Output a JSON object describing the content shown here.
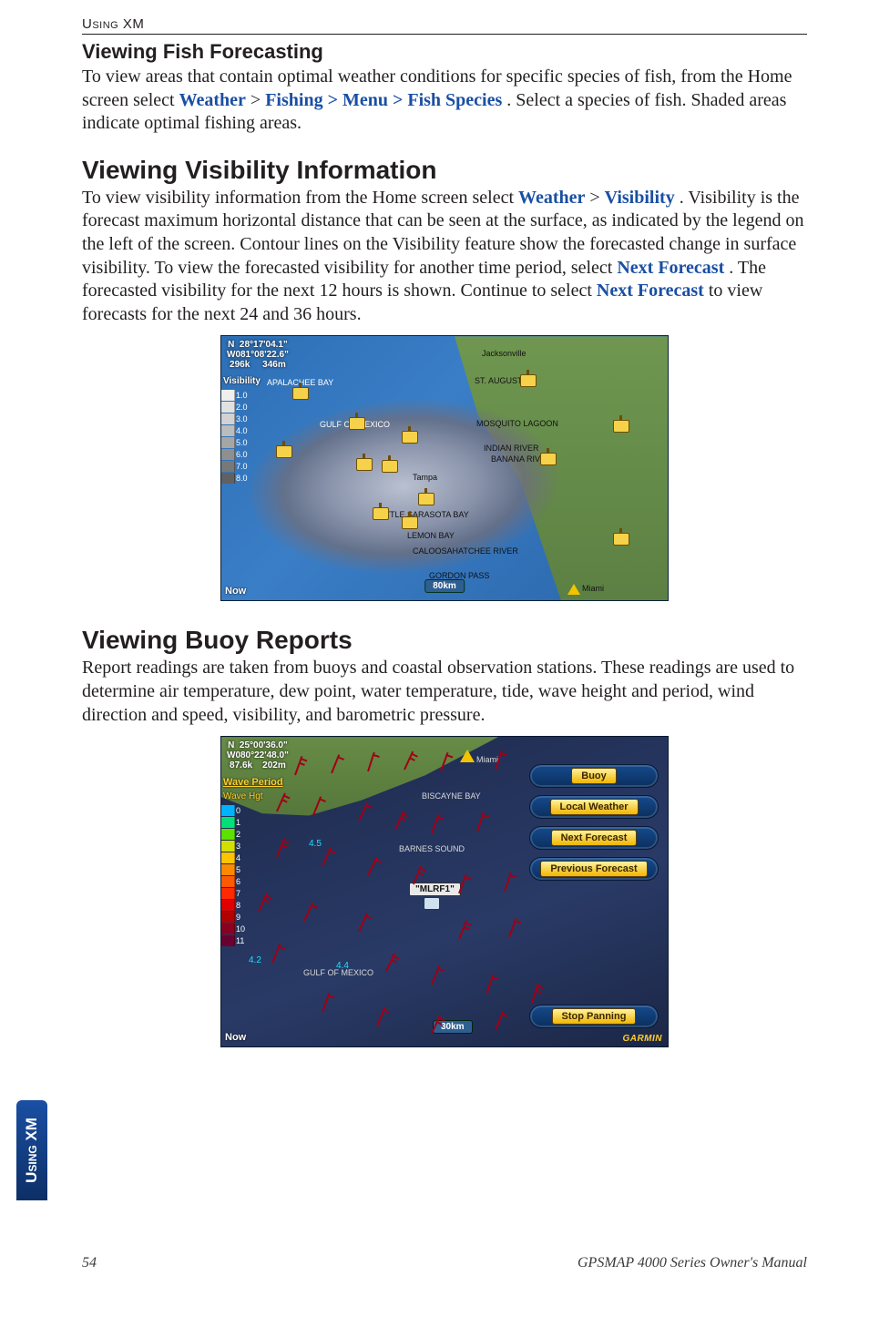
{
  "running_head": "Using XM",
  "fish": {
    "heading": "Viewing Fish Forecasting",
    "p_lead": "To view areas that contain optimal weather conditions for specific species of fish, from the Home screen select ",
    "nav": [
      "Weather",
      "Fishing",
      "Menu",
      "Fish Species"
    ],
    "p_tail": ". Select a species of fish. Shaded areas indicate optimal fishing areas."
  },
  "visibility": {
    "heading": "Viewing Visibility Information",
    "p_lead": "To view visibility information from the Home screen select ",
    "nav1": [
      "Weather",
      "Visibility"
    ],
    "p_mid1": ". Visibility is the forecast maximum horizontal distance that can be seen at the surface, as indicated by the legend on the left of the screen. Contour lines on the Visibility feature show the forecasted change in surface visibility. To view the forecasted visibility for another time period, select ",
    "link_next1": "Next Forecast",
    "p_mid2": ". The forecasted visibility for the next 12 hours is shown. Continue to select ",
    "link_next2": "Next Forecast",
    "p_tail": " to view forecasts for the next 24 and 36 hours."
  },
  "fig1": {
    "coords": "N  28°17'04.1\"\nW081°08'22.6\"\n296k     346m",
    "legend_title": "Visibility",
    "legend": [
      {
        "v": "1.0",
        "c": "#efefef"
      },
      {
        "v": "2.0",
        "c": "#e1e1e1"
      },
      {
        "v": "3.0",
        "c": "#d2d2d2"
      },
      {
        "v": "4.0",
        "c": "#bcbcbc"
      },
      {
        "v": "5.0",
        "c": "#a6a6a6"
      },
      {
        "v": "6.0",
        "c": "#8f8f8f"
      },
      {
        "v": "7.0",
        "c": "#787878"
      },
      {
        "v": "8.0",
        "c": "#616161"
      }
    ],
    "now": "Now",
    "scale": "80km",
    "labels": {
      "jacksonville": "Jacksonville",
      "st_augustine": "ST. AUGUSTINE",
      "gulf": "GULF OF MEXICO",
      "mosquito": "MOSQUITO LAGOON",
      "indian": "INDIAN RIVER",
      "banana": "BANANA RIVER",
      "tampa": "Tampa",
      "little": "LITTLE SARASOTA BAY",
      "lemon": "LEMON BAY",
      "caloosa": "CALOOSAHATCHEE RIVER",
      "gordon": "GORDON PASS",
      "miami": "Miami",
      "apalachee": "APALACHEE BAY"
    }
  },
  "buoy": {
    "heading": "Viewing Buoy Reports",
    "p": "Report readings are taken from buoys and coastal observation stations. These readings are used to determine air temperature, dew point, water temperature, tide, wave height and period, wind direction and speed, visibility, and barometric pressure."
  },
  "fig2": {
    "coords": "N  25°00'36.0\"\nW080°22'48.0\"\n87.6k    202m",
    "legend_title": "Wave Period",
    "legend_sub": "Wave Hgt",
    "legend": [
      {
        "v": "0",
        "c": "#00b3ff"
      },
      {
        "v": "1",
        "c": "#00e07a"
      },
      {
        "v": "2",
        "c": "#5de000"
      },
      {
        "v": "3",
        "c": "#d2e000"
      },
      {
        "v": "4",
        "c": "#ffc400"
      },
      {
        "v": "5",
        "c": "#ff8a00"
      },
      {
        "v": "6",
        "c": "#ff5a00"
      },
      {
        "v": "7",
        "c": "#ff2a00"
      },
      {
        "v": "8",
        "c": "#e00000"
      },
      {
        "v": "9",
        "c": "#b00000"
      },
      {
        "v": "10",
        "c": "#8a0020"
      },
      {
        "v": "11",
        "c": "#6a0030"
      }
    ],
    "now": "Now",
    "brand": "GARMIN",
    "scale": "30km",
    "buttons": {
      "buoy": "Buoy",
      "local": "Local Weather",
      "next": "Next Forecast",
      "prev": "Previous Forecast",
      "stop": "Stop Panning"
    },
    "station": "\"MLRF1\"",
    "labels": {
      "biscayne": "BISCAYNE BAY",
      "barnes": "BARNES SOUND",
      "gulf": "GULF OF MEXICO",
      "miami": "Miami"
    },
    "depths": [
      "4.2",
      "4.5",
      "4.4"
    ]
  },
  "side_tab": "Using XM",
  "footer": {
    "page": "54",
    "manual": "GPSMAP 4000 Series Owner's Manual"
  }
}
